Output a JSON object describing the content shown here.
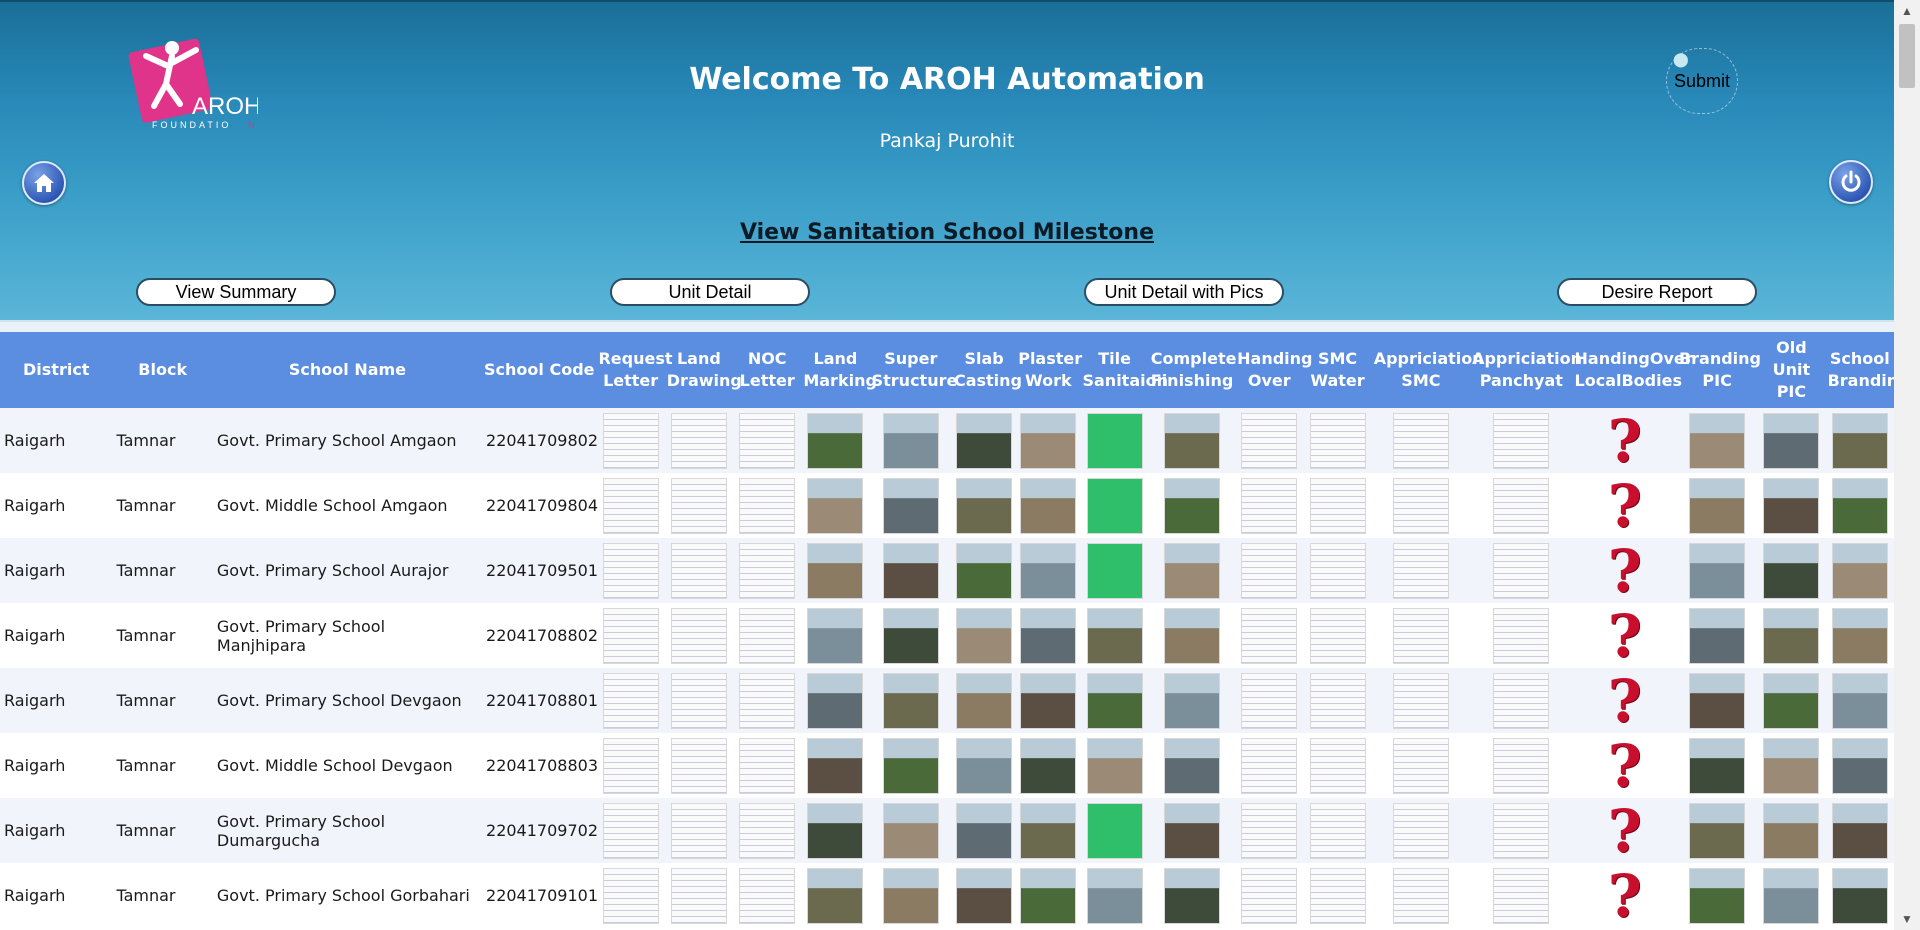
{
  "app": {
    "title": "Welcome To AROH Automation",
    "user": "Pankaj Purohit",
    "submit_label": "Submit",
    "page_heading": "View Sanitation School Milestone",
    "logo_text": "AROH FOUNDATION"
  },
  "nav_buttons": [
    {
      "label": "View Summary"
    },
    {
      "label": "Unit Detail"
    },
    {
      "label": "Unit Detail with Pics"
    },
    {
      "label": "Desire Report"
    }
  ],
  "table": {
    "columns": [
      "District",
      "Block",
      "School Name",
      "School Code",
      "Request Letter",
      "Land Drawing",
      "NOC Letter",
      "Land Marking",
      "Super Structure",
      "Slab Casting",
      "Plaster Work",
      "Tile Sanitaion",
      "Complete Finishing",
      "Handing Over",
      "SMC Water",
      "Appriciation SMC",
      "Appriciation Panchyat",
      "HandingOver LocalBodies",
      "Branding PIC",
      "Old Unit PIC",
      "School Branding"
    ],
    "rows": [
      {
        "district": "Raigarh",
        "block": "Tamnar",
        "school": "Govt. Primary School Amgaon",
        "code": "22041709802"
      },
      {
        "district": "Raigarh",
        "block": "Tamnar",
        "school": "Govt. Middle School Amgaon",
        "code": "22041709804"
      },
      {
        "district": "Raigarh",
        "block": "Tamnar",
        "school": "Govt. Primary School Aurajor",
        "code": "22041709501"
      },
      {
        "district": "Raigarh",
        "block": "Tamnar",
        "school": "Govt. Primary School Manjhipara",
        "code": "22041708802"
      },
      {
        "district": "Raigarh",
        "block": "Tamnar",
        "school": "Govt. Primary School Devgaon",
        "code": "22041708801"
      },
      {
        "district": "Raigarh",
        "block": "Tamnar",
        "school": "Govt. Middle School Devgaon",
        "code": "22041708803"
      },
      {
        "district": "Raigarh",
        "block": "Tamnar",
        "school": "Govt. Primary School Dumargucha",
        "code": "22041709702"
      },
      {
        "district": "Raigarh",
        "block": "Tamnar",
        "school": "Govt. Primary School Gorbahari",
        "code": "22041709101"
      }
    ]
  },
  "icons": {
    "home": "home-icon",
    "power": "power-icon",
    "missing": "question-mark-icon"
  },
  "colors": {
    "header_top": "#1a6f97",
    "header_bottom": "#5bb6d8",
    "table_header": "#5b8de0",
    "missing_icon": "#c8102e"
  }
}
